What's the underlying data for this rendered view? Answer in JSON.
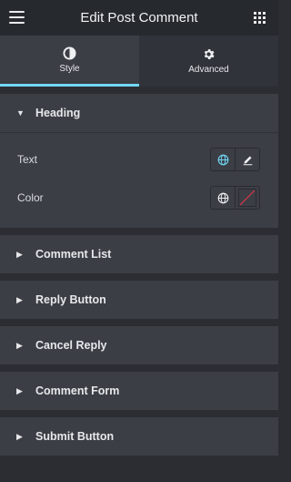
{
  "header": {
    "title": "Edit Post Comment",
    "menu_icon": "hamburger-menu-icon",
    "apps_icon": "grid-icon"
  },
  "tabs": [
    {
      "label": "Style",
      "icon": "contrast-icon",
      "active": true
    },
    {
      "label": "Advanced",
      "icon": "gear-icon",
      "active": false
    }
  ],
  "colors": {
    "accent": "#71d7f7",
    "panel": "#3b3e45",
    "background": "#2b2d33",
    "topbar": "#26292e",
    "clear_color": "#d9364a"
  },
  "sections": [
    {
      "label": "Heading",
      "expanded": true,
      "controls": [
        {
          "label": "Text",
          "buttons": [
            "globe-icon",
            "pencil-icon"
          ]
        },
        {
          "label": "Color",
          "buttons": [
            "globe-icon",
            "color-swatch-empty"
          ]
        }
      ]
    },
    {
      "label": "Comment List",
      "expanded": false
    },
    {
      "label": "Reply Button",
      "expanded": false
    },
    {
      "label": "Cancel Reply",
      "expanded": false
    },
    {
      "label": "Comment Form",
      "expanded": false
    },
    {
      "label": "Submit Button",
      "expanded": false
    }
  ]
}
